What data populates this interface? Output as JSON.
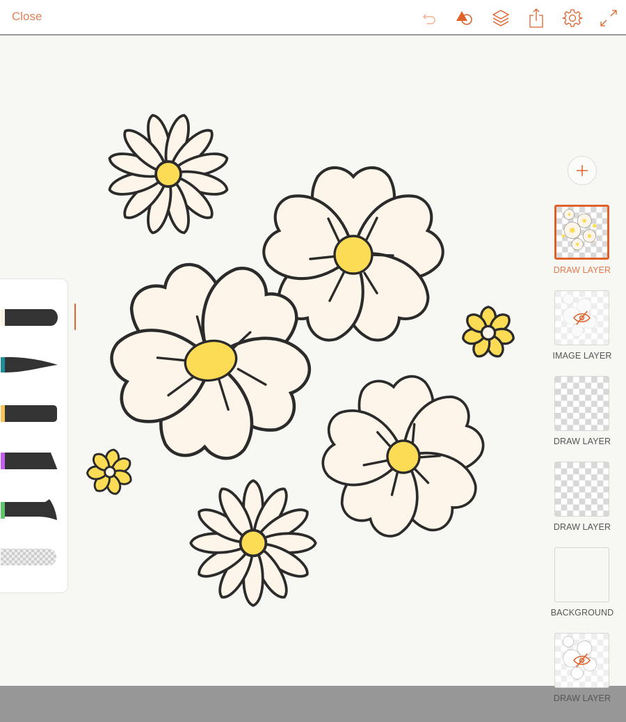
{
  "topbar": {
    "close_label": "Close",
    "icons": [
      "undo-icon",
      "shapes-icon",
      "layers-icon",
      "share-icon",
      "settings-icon",
      "fullscreen-icon"
    ]
  },
  "colors": {
    "accent": "#e0622a",
    "accent_light": "#e0825a",
    "petal": "#fdf5ea",
    "center_yellow": "#fcdc55",
    "outline": "#2b2b2b",
    "canvas_bg": "#f7f7f3",
    "bottom_bar": "#979797"
  },
  "tools": {
    "items": [
      {
        "name": "round-brush",
        "color": "#fdf1e4",
        "selected": true
      },
      {
        "name": "pointed-brush",
        "color": "#1e8e9d",
        "selected": false
      },
      {
        "name": "flat-brush",
        "color": "#f8c35a",
        "selected": false
      },
      {
        "name": "chisel-brush",
        "color": "#c35ef1",
        "selected": false
      },
      {
        "name": "flared-brush",
        "color": "#5ec56a",
        "selected": false
      },
      {
        "name": "eraser",
        "color": "",
        "selected": false
      }
    ]
  },
  "layers": {
    "add_label": "+",
    "items": [
      {
        "label": "DRAW LAYER",
        "selected": true,
        "hidden": false,
        "thumb": "flowers-color"
      },
      {
        "label": "IMAGE LAYER",
        "selected": false,
        "hidden": true,
        "thumb": "flowers-faded"
      },
      {
        "label": "DRAW LAYER",
        "selected": false,
        "hidden": false,
        "thumb": "empty-transparent"
      },
      {
        "label": "DRAW LAYER",
        "selected": false,
        "hidden": false,
        "thumb": "empty-transparent"
      },
      {
        "label": "BACKGROUND",
        "selected": false,
        "hidden": false,
        "thumb": "solid"
      },
      {
        "label": "DRAW LAYER",
        "selected": false,
        "hidden": true,
        "thumb": "flowers-outline"
      }
    ]
  },
  "artwork": {
    "flowers": [
      {
        "type": "daisy",
        "petals": 12,
        "center": "yellow"
      },
      {
        "type": "five-petal",
        "petals": 5,
        "center": "yellow"
      },
      {
        "type": "five-petal-large",
        "petals": 5,
        "center": "yellow-oval"
      },
      {
        "type": "small-yellow",
        "petals": 7,
        "center": "white"
      },
      {
        "type": "five-petal",
        "petals": 5,
        "center": "yellow"
      },
      {
        "type": "small-yellow",
        "petals": 7,
        "center": "white"
      },
      {
        "type": "daisy",
        "petals": 12,
        "center": "yellow"
      }
    ]
  }
}
